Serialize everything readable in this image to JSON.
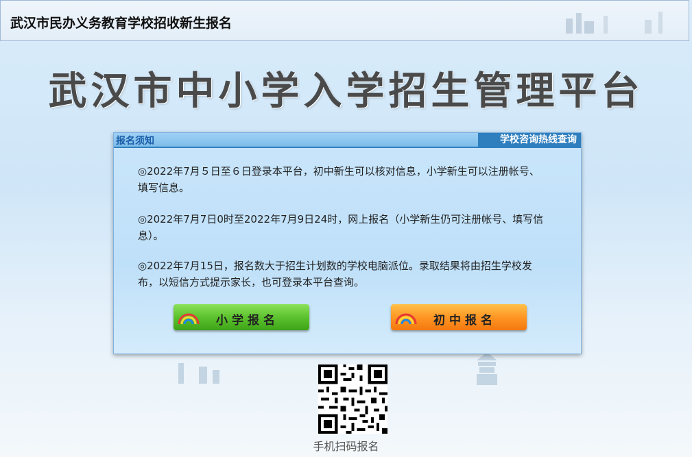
{
  "header": {
    "title": "武汉市民办义务教育学校招收新生报名"
  },
  "main": {
    "title": "武汉市中小学入学招生管理平台"
  },
  "panel": {
    "label": "报名须知",
    "tab": "学校咨询热线查询",
    "notices": [
      {
        "text": "◎2022年7月５日至６日登录本平台，初中新生可以核对信息，小学新生可以注册帐号、填写信息。"
      },
      {
        "text": "◎2022年7月7日0时至2022年7月9日24时，网上报名（小学新生仍可注册帐号、填写信息）。"
      },
      {
        "text": "◎2022年7月15日，报名数大于招生计划数的学校电脑派位。录取结果将由招生学校发布，以短信方式提示家长，也可登录本平台查询。"
      }
    ],
    "buttons": {
      "primary": "小学报名",
      "middle": "初中报名"
    }
  },
  "qr": {
    "caption": "手机扫码报名"
  },
  "colors": {
    "primary_btn": "#5cc22e",
    "middle_btn": "#ff9624",
    "tab": "#2f7fbf"
  }
}
